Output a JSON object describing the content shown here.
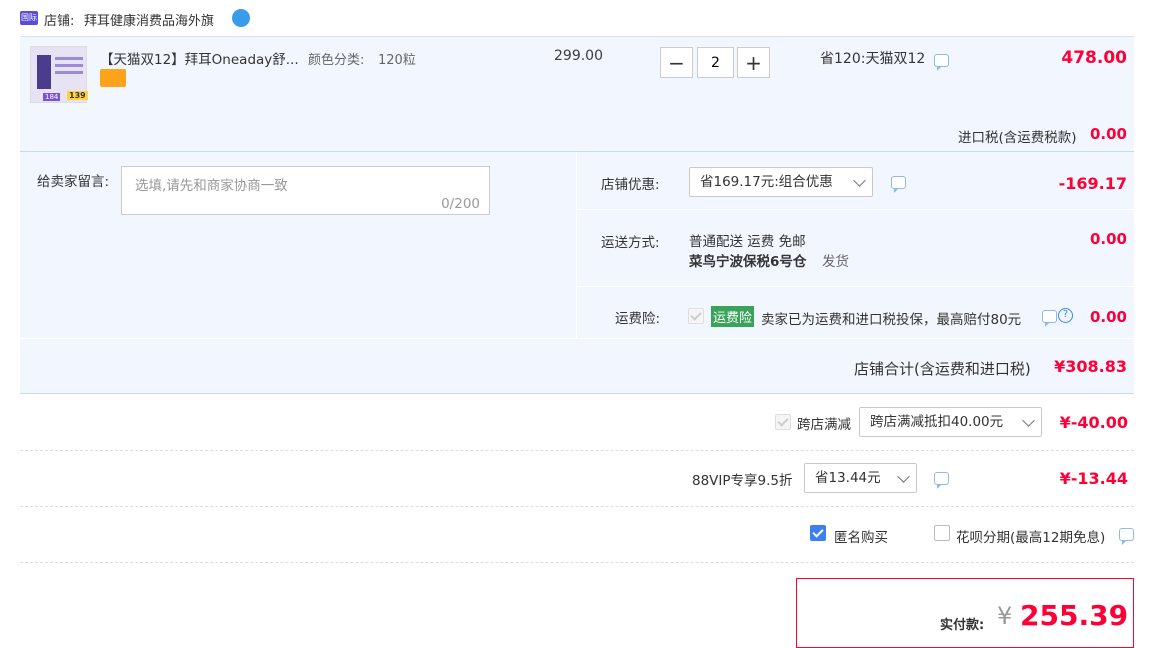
{
  "shop": {
    "badge": "国际",
    "label": "店铺:",
    "name": "拜耳健康消费品海外旗"
  },
  "item": {
    "title": "【天猫双12】拜耳Oneaday舒...",
    "sku_label": "颜色分类:",
    "sku_value": "120粒",
    "unit_price": "299.00",
    "qty": "2",
    "qty_minus": "−",
    "qty_plus": "+",
    "promo": "省120:天猫双12",
    "subtotal": "478.00",
    "thumb_price_a": "184",
    "thumb_price_b": "139"
  },
  "tax": {
    "label": "进口税(含运费税款)",
    "value": "0.00"
  },
  "message": {
    "label": "给卖家留言:",
    "placeholder": "选填,请先和商家协商一致",
    "counter": "0/200"
  },
  "discount": {
    "label": "店铺优惠:",
    "selected": "省169.17元:组合优惠",
    "value": "-169.17"
  },
  "shipping": {
    "label": "运送方式:",
    "method": "普通配送 运费 免邮",
    "warehouse": "菜鸟宁波保税6号仓",
    "ship_text": "发货",
    "value": "0.00"
  },
  "insurance": {
    "label": "运费险:",
    "tag": "运费险",
    "desc": "卖家已为运费和进口税投保，最高赔付80元",
    "value": "0.00"
  },
  "shop_total": {
    "label": "店铺合计(含运费和进口税)",
    "value": "¥308.83"
  },
  "cross_store": {
    "label": "跨店满减",
    "selected": "跨店满减抵扣40.00元",
    "value": "¥-40.00"
  },
  "vip": {
    "label": "88VIP专享9.5折",
    "selected": "省13.44元",
    "value": "¥-13.44"
  },
  "options": {
    "anonymous": "匿名购买",
    "anonymous_checked": true,
    "huabei": "花呗分期(最高12期免息)",
    "huabei_checked": false
  },
  "payment": {
    "label": "实付款:",
    "currency": "¥",
    "amount": "255.39"
  },
  "colors": {
    "accent": "#ff0036",
    "panel": "#f2f7ff",
    "link": "#3388ff"
  }
}
